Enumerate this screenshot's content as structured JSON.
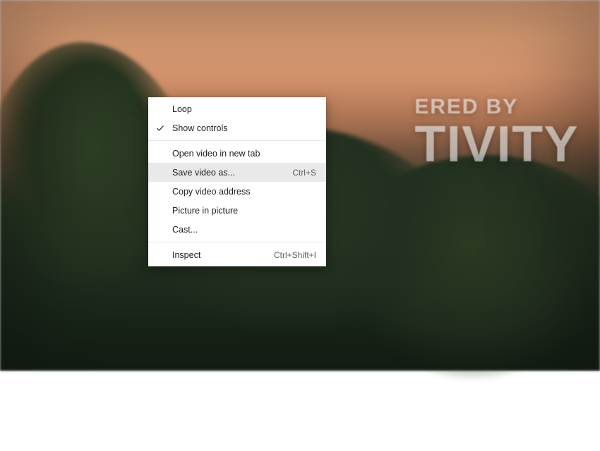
{
  "overlay_text": {
    "line1": "ERED BY",
    "line2": "TIVITY"
  },
  "context_menu": {
    "items": [
      {
        "label": "Loop",
        "shortcut": "",
        "checked": false,
        "highlighted": false
      },
      {
        "label": "Show controls",
        "shortcut": "",
        "checked": true,
        "highlighted": false
      }
    ],
    "items2": [
      {
        "label": "Open video in new tab",
        "shortcut": "",
        "highlighted": false
      },
      {
        "label": "Save video as...",
        "shortcut": "Ctrl+S",
        "highlighted": true
      },
      {
        "label": "Copy video address",
        "shortcut": "",
        "highlighted": false
      },
      {
        "label": "Picture in picture",
        "shortcut": "",
        "highlighted": false
      },
      {
        "label": "Cast...",
        "shortcut": "",
        "highlighted": false
      }
    ],
    "items3": [
      {
        "label": "Inspect",
        "shortcut": "Ctrl+Shift+I",
        "highlighted": false
      }
    ]
  }
}
